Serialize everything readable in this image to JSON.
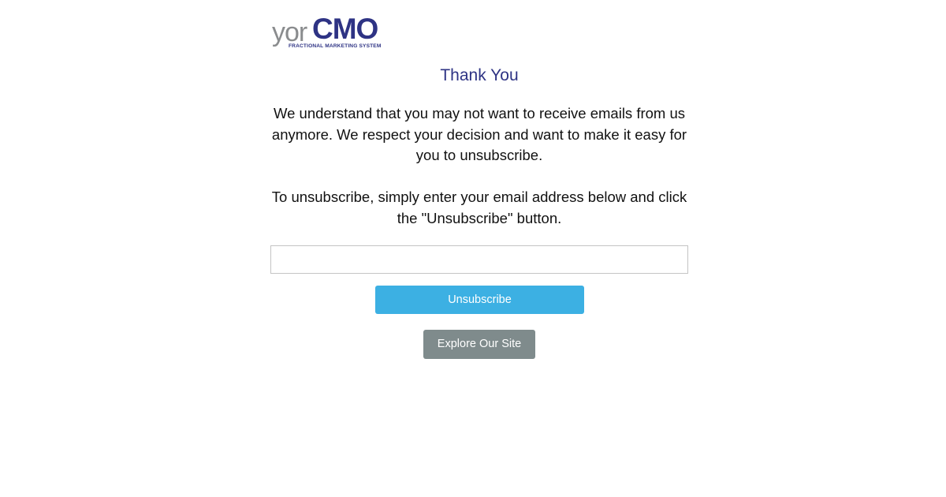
{
  "logo": {
    "part1": "yor",
    "part2": "CMO",
    "tagline": "FRACTIONAL MARKETING SYSTEM",
    "colors": {
      "part1": "#8a8c8e",
      "part2": "#2e3384"
    }
  },
  "heading": "Thank You",
  "paragraphs": {
    "intro": "We understand that you may not want to receive emails from us anymore. We respect your decision and want to make it easy for you to unsubscribe.",
    "instructions": "To unsubscribe, simply enter your email address below and click the \"Unsubscribe\" button."
  },
  "form": {
    "email_value": "",
    "email_placeholder": "",
    "unsubscribe_label": "Unsubscribe"
  },
  "explore_label": "Explore Our Site",
  "colors": {
    "heading": "#2e3384",
    "unsubscribe_button": "#3cb0e3",
    "explore_button": "#7f8b8c"
  }
}
